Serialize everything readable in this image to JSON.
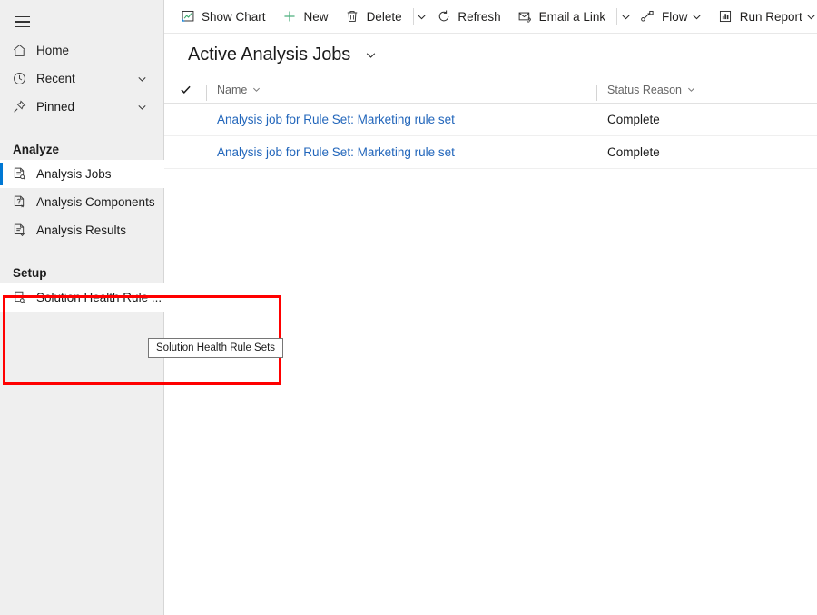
{
  "sidebar": {
    "menu_button": "site-map-menu",
    "top_items": [
      {
        "label": "Home",
        "icon": "home-icon",
        "chevron": false
      },
      {
        "label": "Recent",
        "icon": "clock-icon",
        "chevron": true
      },
      {
        "label": "Pinned",
        "icon": "pin-icon",
        "chevron": true
      }
    ],
    "groups": [
      {
        "title": "Analyze",
        "items": [
          {
            "label": "Analysis Jobs",
            "icon": "analysis-jobs-icon",
            "selected": true,
            "hovered": false
          },
          {
            "label": "Analysis Components",
            "icon": "analysis-components-icon",
            "selected": false,
            "hovered": false
          },
          {
            "label": "Analysis Results",
            "icon": "analysis-results-icon",
            "selected": false,
            "hovered": false
          }
        ]
      },
      {
        "title": "Setup",
        "items": [
          {
            "label": "Solution Health Rule ...",
            "icon": "solution-health-rule-sets-icon",
            "selected": false,
            "hovered": true
          }
        ]
      }
    ]
  },
  "commandbar": {
    "items": [
      {
        "label": "Show Chart",
        "icon": "chart-icon",
        "type": "button"
      },
      {
        "label": "New",
        "icon": "plus-icon",
        "type": "button"
      },
      {
        "label": "Delete",
        "icon": "trash-icon",
        "type": "button"
      },
      {
        "label": "",
        "icon": "chevron-down-icon",
        "type": "overflow-caret",
        "separator_before": true
      },
      {
        "label": "Refresh",
        "icon": "refresh-icon",
        "type": "button"
      },
      {
        "label": "Email a Link",
        "icon": "email-link-icon",
        "type": "button"
      },
      {
        "label": "",
        "icon": "chevron-down-icon",
        "type": "overflow-caret",
        "separator_before": true
      },
      {
        "label": "Flow",
        "icon": "flow-icon",
        "type": "button",
        "caret_after": true
      },
      {
        "label": "Run Report",
        "icon": "run-report-icon",
        "type": "button",
        "caret_after": true
      }
    ]
  },
  "view": {
    "title": "Active Analysis Jobs",
    "title_caret": "chevron-down-icon"
  },
  "grid": {
    "select_all_icon": "checkmark-icon",
    "columns": [
      {
        "key": "name",
        "label": "Name",
        "caret": "chevron-down-icon"
      },
      {
        "key": "status",
        "label": "Status Reason",
        "caret": "chevron-down-icon"
      }
    ],
    "rows": [
      {
        "name": "Analysis job for Rule Set: Marketing rule set",
        "status": "Complete"
      },
      {
        "name": "Analysis job for Rule Set: Marketing rule set",
        "status": "Complete"
      }
    ]
  },
  "tooltip": {
    "text": "Solution Health Rule Sets"
  },
  "annotation": {
    "highlight_color": "#ff0000"
  },
  "colors": {
    "accent": "#0078d4",
    "link": "#2266bb",
    "sidebar_bg": "#efefef",
    "new_icon_green": "#4caf7d"
  }
}
